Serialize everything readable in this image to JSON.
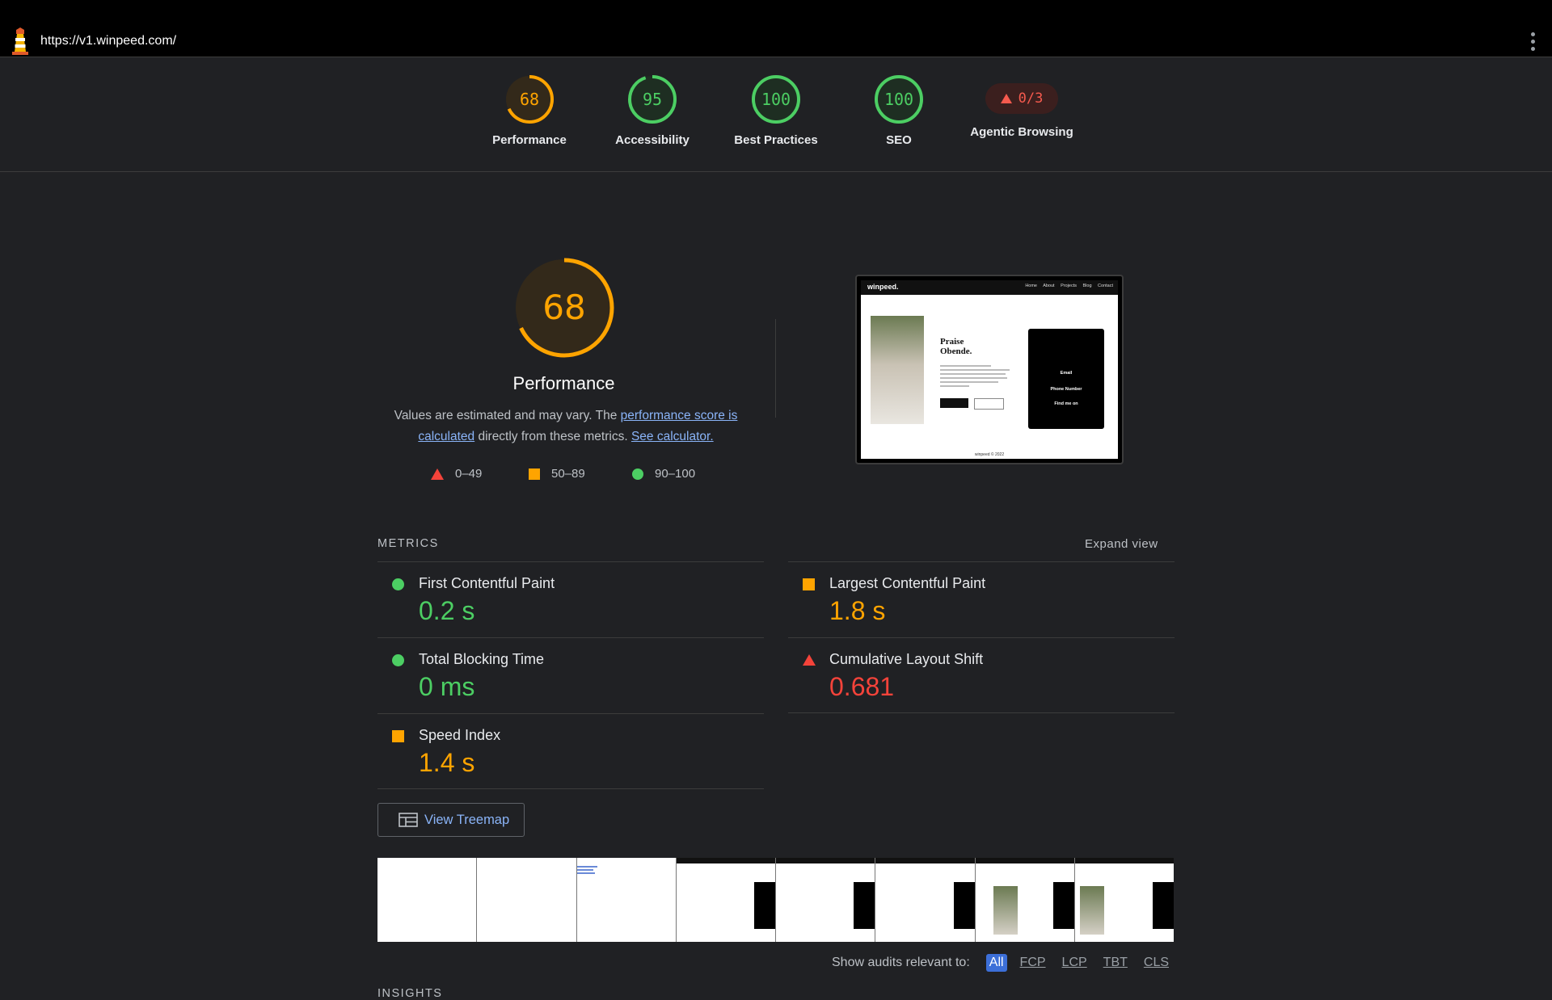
{
  "url": "https://v1.winpeed.com/",
  "gauges": [
    {
      "score": "68",
      "label": "Performance",
      "color": "#ffa400",
      "fraction": 0.68
    },
    {
      "score": "95",
      "label": "Accessibility",
      "color": "#4cce63",
      "fraction": 0.95
    },
    {
      "score": "100",
      "label": "Best Practices",
      "color": "#4cce63",
      "fraction": 1.0
    },
    {
      "score": "100",
      "label": "SEO",
      "color": "#4cce63",
      "fraction": 1.0
    }
  ],
  "agentic": {
    "score": "0/3",
    "label": "Agentic Browsing",
    "color": "#f55a4e"
  },
  "performance": {
    "score": "68",
    "fraction": 0.68,
    "title": "Performance",
    "desc_pre": "Values are estimated and may vary. The ",
    "desc_link1": "performance score is calculated",
    "desc_mid": " directly from these metrics. ",
    "desc_link2": "See calculator."
  },
  "legend": [
    {
      "range": "0–49",
      "shape": "triangle",
      "color": "#f4433a"
    },
    {
      "range": "50–89",
      "shape": "square",
      "color": "#ffa400"
    },
    {
      "range": "90–100",
      "shape": "circle",
      "color": "#4cce63"
    }
  ],
  "screenshot": {
    "brand": "winpeed.",
    "nav_links": "Home About Projects Blog Contact",
    "name_line1": "Praise",
    "name_line2": "Obende.",
    "card_email": "Email",
    "card_phone": "Phone Number",
    "card_find": "Find me on",
    "footer": "winpeed © 2022"
  },
  "metrics_header": "METRICS",
  "expand_view": "Expand view",
  "metrics": [
    {
      "title": "First Contentful Paint",
      "value": "0.2 s",
      "status": "good"
    },
    {
      "title": "Largest Contentful Paint",
      "value": "1.8 s",
      "status": "average"
    },
    {
      "title": "Total Blocking Time",
      "value": "0 ms",
      "status": "good"
    },
    {
      "title": "Cumulative Layout Shift",
      "value": "0.681",
      "status": "poor"
    },
    {
      "title": "Speed Index",
      "value": "1.4 s",
      "status": "average"
    }
  ],
  "treemap_label": "View Treemap",
  "audit_filter": {
    "label": "Show audits relevant to:",
    "chips": [
      "All",
      "FCP",
      "LCP",
      "TBT",
      "CLS"
    ],
    "active": "All"
  },
  "insights_header": "INSIGHTS"
}
